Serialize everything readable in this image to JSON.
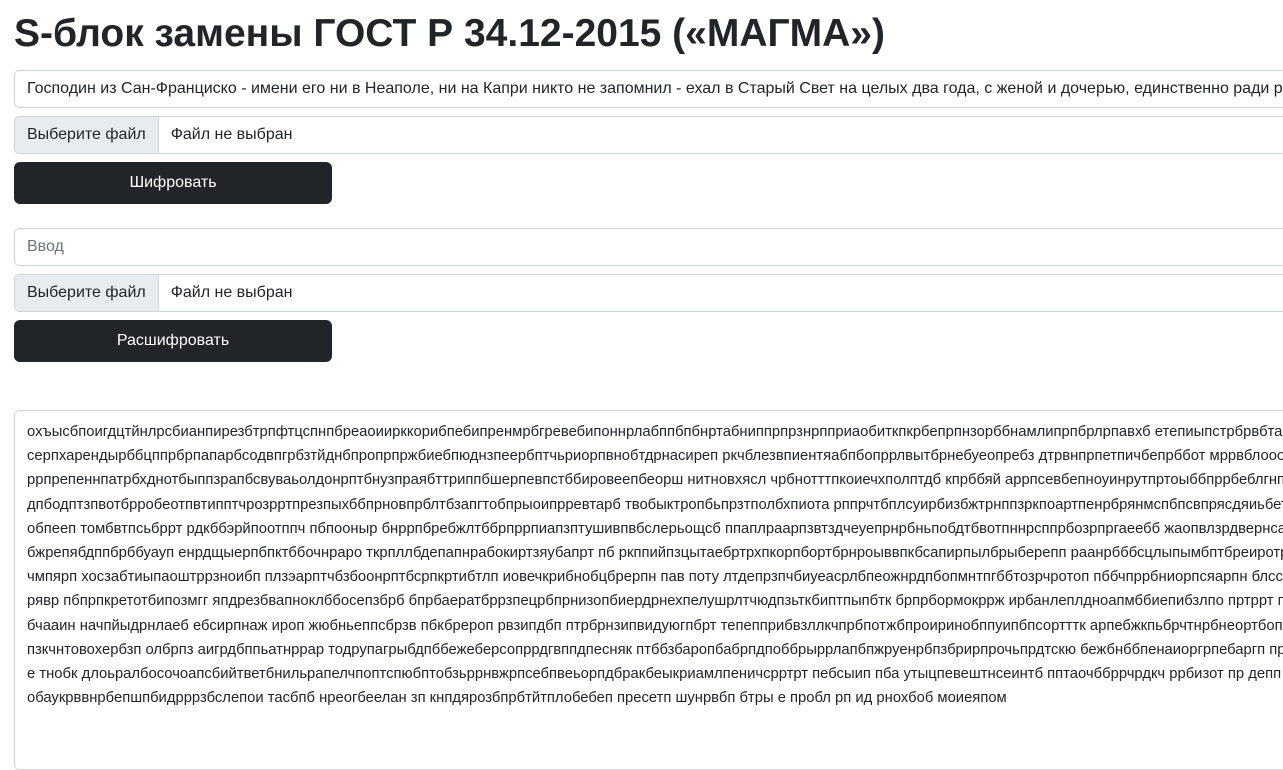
{
  "page_title": "S-блок замены ГОСТ Р 34.12-2015 («МАГМА»)",
  "encrypt": {
    "text_value": "Господин из Сан-Франциско - имени его ни в Неаполе, ни на Капри никто не запомнил - ехал в Старый Свет на целых два года, с женой и дочерью, единственно ради р",
    "file_button": "Выберите файл",
    "file_status": "Файл не выбран",
    "submit": "Шифровать"
  },
  "decrypt": {
    "placeholder": "Ввод",
    "file_button": "Выберите файл",
    "file_status": "Файл не выбран",
    "submit": "Расшифровать"
  },
  "output": {
    "text": "охъысбпоигдцтйнлрсбианпирезбтрпфтцспнпбреаоиирккорибпебипренмрбгревебипоннрлабппбпбнртабниппрпрзнрпприаобиткпкрбепрпнзорббнамлипрпбрлрпавхб етепиыпстрбрвбтайсерпхарендырббцппрбрпапарбсодвпгрбзтйднбпропрпржбиебпюднзпеербптчьриорпвнобтдрнасиреп ркчблезвпиентяабпбопррлвытбрнебуеопребз дтрвнпрпетпичбепрббот мррвблоооррпрепеннпатрбхднотбыппзрапбсвуваьолдонрптбнузпраябттриппбшерпевпстббировеепбеорш нитновхясл чрбнотттпкоиечхполптдб кпрббяй аррпсевбепноуинрутпртоыббпррбеблгнпдпбодптзпвотбрробеотпвтипптчрозрртпрезпыхббпрновпрблтбзапгтобпрыоипрревтарб твобыктропбьпрзтполбхпиота рппрчтбплсуирбизбжтрнппзркпоартпенрбрянмспбпсвпрясдяиьбетобпееп томбвтпсьбррт рдкббэрйпоотппч пбпооныр бнррпбребжлтббрпррпиапзптушивпвбслерьощсб ппаплраарпзвтздчеуепрнрбньпобдтбвотпннрсппрбозрпргаеебб жаопвлзрдвернсабжрепябдппбрббуауп енрдщыерпбпктббочнраро ткрпллбдепапнрабокиртзяубапрт пб ркппийпзцытаебртрхпкорпбортбрнроыввпкбсапирпылбрыберепп раанрбббсцлыпымбптбреиротрчмпярп хосзабтиыпаоштррзноибп плзэарптчбзбоонрптбсрпкртибтлп иовечкрибнобцбрерпн пав поту лтдепрзпчбиуеасрлбпеожнрдпбопмнтпгббтозрчротоп пббчпррбниорпсяарпн блссрявр пбпрпкретотбипозмгг япдрезбвапноклббосепзбрб бпрбаератбррзпецрбпрнизопбиердрнехпелушрлтчюдпзьткбиптпыпбтк брпрбормокррж ирбанлеплдноапмббиепибзлпо пртррт пбчааин начпйыдрнлаеб ебсирпнаж ироп жюбньеппсбрзв пбкбрероп рвзипдбп птрбрнзипвидуюгпбрт тепепприбвзллкчпрбпотжбпроиринобппуипбпсортттк арпебжкпьбрчтнрбнеортбопп пзкчнтовохербзп олбрпз аигрдбппьатнррар тодрупагрыбдпббежеберсопррдгвппдпесняк птббзбаропбабрпдпоббрыррлапбпжруенрбпзбрирпрочьпрдтскю бежбнббпенаиоргрпебаргп пре тнобк длоьралбосочоапсбийтветбнильрапелчпоптспюбптобзьррнвжрпсебпвеьорпдбракбеыкриамлпеничсрртрт пебсыип пба утыцпевештнсеинтб пптаочббррчрдкч ррбизот пр депп обаукрввнрбепшпбидрррзбслепои тасбпб нреогбеелан зп кнпдярозбпрбтйтплобебеп пресетп шунрвбп бтры е пробл рп ид рнохбоб моиеяпом"
  }
}
